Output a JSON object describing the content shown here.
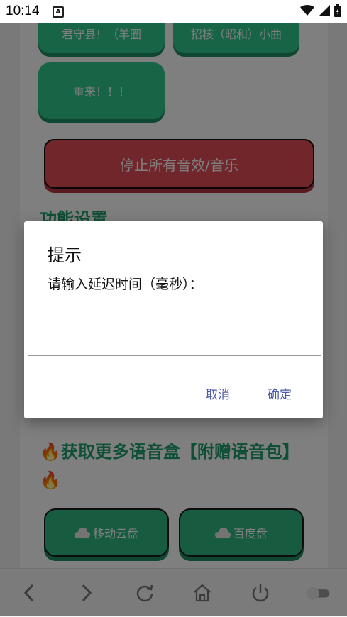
{
  "status_bar": {
    "time": "10:14",
    "notification_glyph": "A",
    "icons": [
      "wifi-icon",
      "signal-icon",
      "battery-charging-icon"
    ]
  },
  "page": {
    "buttons_top": [
      {
        "label": "君守县！（羊圈"
      },
      {
        "label": "招核（昭和）小曲"
      },
      {
        "label": "重来！！！"
      }
    ],
    "stop_button": "停止所有音效/音乐",
    "section_settings": "功能设置",
    "section_more": {
      "fire_icon": "🔥",
      "text": "获取更多语音盒【附赠语音包】"
    },
    "download_buttons": [
      {
        "icon": "cloud-icon",
        "label": "移动云盘"
      },
      {
        "icon": "cloud-icon",
        "label": "百度盘"
      }
    ]
  },
  "dialog": {
    "title": "提示",
    "message": "请输入延迟时间（毫秒）：",
    "input_value": "",
    "cancel_label": "取消",
    "confirm_label": "确定"
  },
  "bottom_bar": {
    "icons": [
      "back-icon",
      "forward-icon",
      "refresh-icon",
      "home-icon",
      "power-icon",
      "toggle-switch"
    ]
  },
  "colors": {
    "green_button": "#2fc88f",
    "red_button": "#e04d56",
    "section_text": "#1f9f6a",
    "dialog_button_text": "#4a5aa8"
  }
}
